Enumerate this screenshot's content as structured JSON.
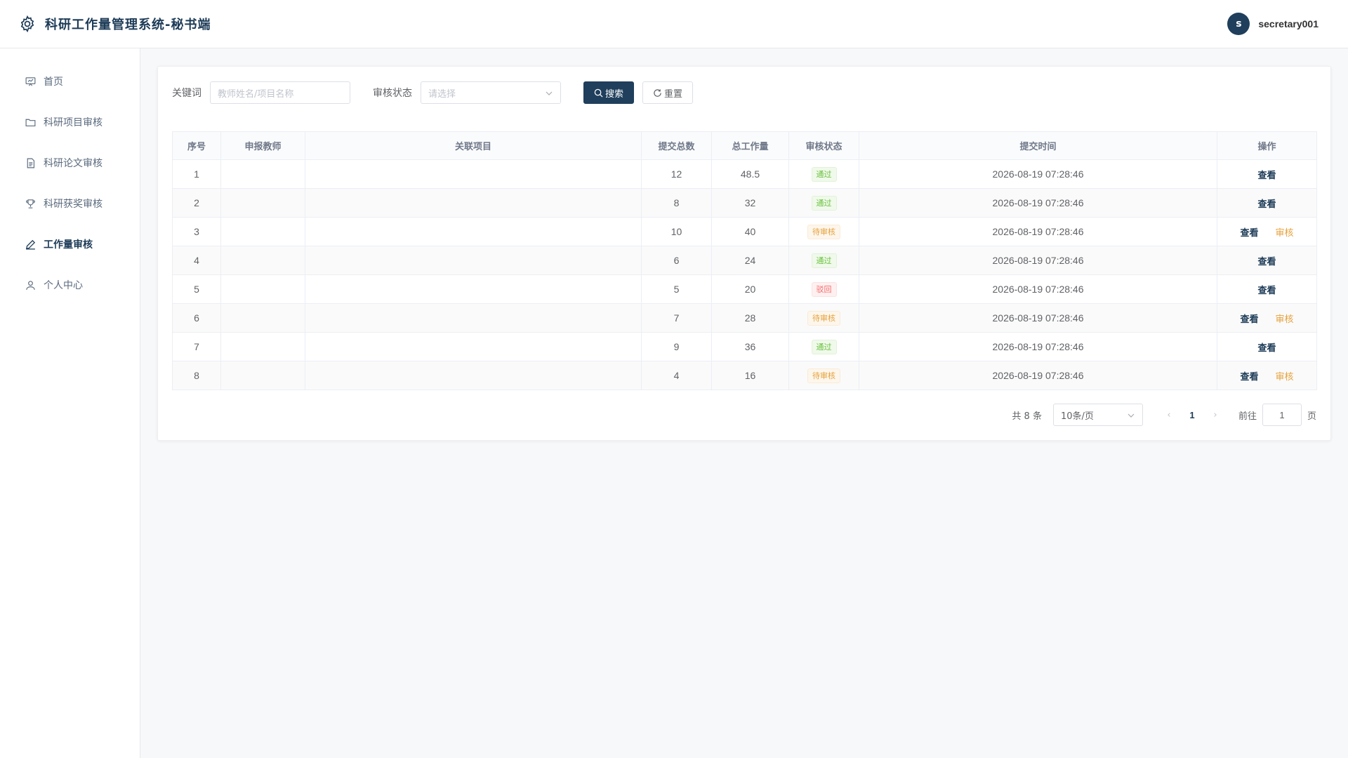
{
  "app": {
    "title": "科研工作量管理系统-秘书端"
  },
  "user": {
    "avatar_letter": "s",
    "name": "secretary001"
  },
  "sidebar": {
    "items": [
      {
        "label": "首页",
        "icon": "dashboard-icon",
        "active": false
      },
      {
        "label": "科研项目审核",
        "icon": "folder-icon",
        "active": false
      },
      {
        "label": "科研论文审核",
        "icon": "document-icon",
        "active": false
      },
      {
        "label": "科研获奖审核",
        "icon": "trophy-icon",
        "active": false
      },
      {
        "label": "工作量审核",
        "icon": "edit-pen-icon",
        "active": true
      },
      {
        "label": "个人中心",
        "icon": "user-icon",
        "active": false
      }
    ]
  },
  "filters": {
    "keyword_label": "关键词",
    "keyword_placeholder": "教师姓名/项目名称",
    "keyword_value": "",
    "status_label": "审核状态",
    "status_placeholder": "请选择",
    "search_label": "搜索",
    "reset_label": "重置"
  },
  "table": {
    "columns": [
      "序号",
      "申报教师",
      "关联项目",
      "提交总数",
      "总工作量",
      "审核状态",
      "提交时间",
      "操作"
    ],
    "rows": [
      {
        "index": "1",
        "teacher": "",
        "project": "",
        "count": "12",
        "workload": "48.5",
        "status": "通过",
        "status_type": "pass",
        "time": "2026-08-19 07:28:46",
        "actions": [
          "查看"
        ]
      },
      {
        "index": "2",
        "teacher": "",
        "project": "",
        "count": "8",
        "workload": "32",
        "status": "通过",
        "status_type": "pass",
        "time": "2026-08-19 07:28:46",
        "actions": [
          "查看"
        ]
      },
      {
        "index": "3",
        "teacher": "",
        "project": "",
        "count": "10",
        "workload": "40",
        "status": "待审核",
        "status_type": "pending",
        "time": "2026-08-19 07:28:46",
        "actions": [
          "查看",
          "审核"
        ]
      },
      {
        "index": "4",
        "teacher": "",
        "project": "",
        "count": "6",
        "workload": "24",
        "status": "通过",
        "status_type": "pass",
        "time": "2026-08-19 07:28:46",
        "actions": [
          "查看"
        ]
      },
      {
        "index": "5",
        "teacher": "",
        "project": "",
        "count": "5",
        "workload": "20",
        "status": "驳回",
        "status_type": "reject",
        "time": "2026-08-19 07:28:46",
        "actions": [
          "查看"
        ]
      },
      {
        "index": "6",
        "teacher": "",
        "project": "",
        "count": "7",
        "workload": "28",
        "status": "待审核",
        "status_type": "pending",
        "time": "2026-08-19 07:28:46",
        "actions": [
          "查看",
          "审核"
        ]
      },
      {
        "index": "7",
        "teacher": "",
        "project": "",
        "count": "9",
        "workload": "36",
        "status": "通过",
        "status_type": "pass",
        "time": "2026-08-19 07:28:46",
        "actions": [
          "查看"
        ]
      },
      {
        "index": "8",
        "teacher": "",
        "project": "",
        "count": "4",
        "workload": "16",
        "status": "待审核",
        "status_type": "pending",
        "time": "2026-08-19 07:28:46",
        "actions": [
          "查看",
          "审核"
        ]
      }
    ]
  },
  "pagination": {
    "total_text": "共 8 条",
    "page_size": "10条/页",
    "prev": "‹",
    "current_page": "1",
    "next": "›",
    "goto_label": "前往",
    "goto_value": "1",
    "page_suffix": "页"
  },
  "colors": {
    "brand": "#1f3f5c",
    "pass": "#67c23a",
    "pending": "#e6a23c",
    "reject": "#f56c6c"
  }
}
